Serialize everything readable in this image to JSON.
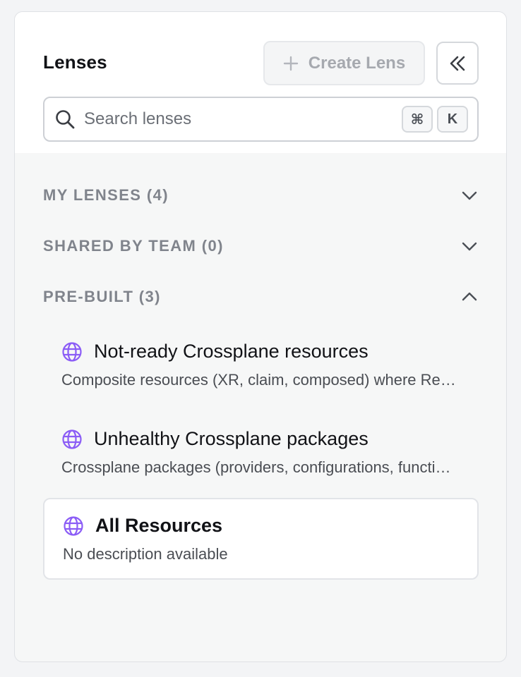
{
  "header": {
    "title": "Lenses",
    "create_button_label": "Create Lens"
  },
  "search": {
    "placeholder": "Search lenses",
    "value": "",
    "shortcut_modifier": "⌘",
    "shortcut_key": "K"
  },
  "sections": [
    {
      "label": "MY LENSES (4)",
      "expanded": false
    },
    {
      "label": "SHARED BY TEAM (0)",
      "expanded": false
    },
    {
      "label": "PRE-BUILT (3)",
      "expanded": true
    }
  ],
  "prebuilt_lenses": [
    {
      "name": "Not-ready Crossplane resources",
      "description": "Composite resources (XR, claim, composed) where Ready is not True",
      "selected": false
    },
    {
      "name": "Unhealthy Crossplane packages",
      "description": "Crossplane packages (providers, configurations, functions) that are not healthy",
      "selected": false
    },
    {
      "name": "All Resources",
      "description": "No description available",
      "selected": true
    }
  ],
  "colors": {
    "accent_globe": "#8b5cf6",
    "section_label": "#80848c",
    "panel_bg": "#f6f7f7"
  },
  "icons": {
    "create": "plus-icon",
    "collapse": "double-chevron-left-icon",
    "search": "search-icon",
    "collapsed_section": "chevron-down-icon",
    "expanded_section": "chevron-up-icon",
    "lens": "globe-icon"
  }
}
